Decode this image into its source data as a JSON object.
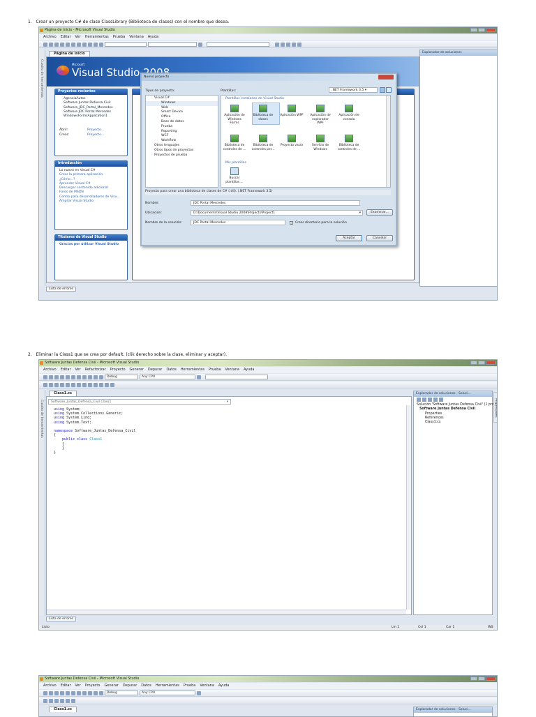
{
  "steps": [
    {
      "number": "1.",
      "text": "Crear un proyecto C# de clase ClassLibrary (Biblioteca de clases) con el nombre que desea."
    },
    {
      "number": "2.",
      "text": "Eliminar la Class1 que se crea por default. (clik derecho sobre la clase, eliminar y aceptar)."
    }
  ],
  "shot1": {
    "title": "Página de inicio - Microsoft Visual Studio",
    "menu": [
      "Archivo",
      "Editar",
      "Ver",
      "Herramientas",
      "Prueba",
      "Ventana",
      "Ayuda"
    ],
    "side_strip": "Cuadro de herramientas",
    "tab": "Página de inicio",
    "logo_small": "Microsoft",
    "logo": "Visual Studio 2008",
    "recent": {
      "title": "Proyectos recientes",
      "items": [
        "AgenciaAutos",
        "Software Juntas Defensa Civil",
        "Software_JDC_Portal_Mercedes",
        "Software JDC Portal Mercedes",
        "WindowsFormsApplication1"
      ],
      "open_label": "Abrir:",
      "open_link": "Proyecto...",
      "create_label": "Crear:",
      "create_link": "Proyecto..."
    },
    "intro": {
      "title": "Introducción",
      "items": [
        "Lo nuevo en Visual C#",
        "Crear la primera aplicación",
        "¿Cómo...?",
        "Aprender Visual C#",
        "Descargar contenido adicional",
        "Foros de MSDN",
        "Centro para desarrolladores de Visu...",
        "Ampliar Visual Studio"
      ]
    },
    "headlines": {
      "title": "Titulares de Visual Studio",
      "item": "Gracias por utilizar Visual Studio"
    },
    "solution_explorer": "Explorador de soluciones",
    "bottom_tab": "Lista de errores",
    "dialog": {
      "title": "Nuevo proyecto",
      "types_label": "Tipos de proyecto:",
      "types": [
        {
          "t": "Visual C#",
          "l": 0
        },
        {
          "t": "Windows",
          "l": 1
        },
        {
          "t": "Web",
          "l": 1
        },
        {
          "t": "Smart Device",
          "l": 1
        },
        {
          "t": "Office",
          "l": 1
        },
        {
          "t": "Base de datos",
          "l": 1
        },
        {
          "t": "Prueba",
          "l": 1
        },
        {
          "t": "Reporting",
          "l": 1
        },
        {
          "t": "WCF",
          "l": 1
        },
        {
          "t": "Workflow",
          "l": 1
        },
        {
          "t": "Otros lenguajes",
          "l": 0
        },
        {
          "t": "Otros tipos de proyectos",
          "l": 0
        },
        {
          "t": "Proyectos de prueba",
          "l": 0
        }
      ],
      "templates_label": "Plantillas:",
      "framework": ".NET Framework 3.5",
      "installed_label": "Plantillas instaladas de Visual Studio",
      "templates": [
        "Aplicación de Windows Forms",
        "Biblioteca de clases",
        "Aplicación WPF",
        "Aplicación de explorador WPF",
        "Aplicación de consola",
        "Biblioteca de controles de ...",
        "Biblioteca de controles per...",
        "Proyecto vacío",
        "Servicio de Windows",
        "Biblioteca de controles de ..."
      ],
      "my_templates_label": "Mis plantillas",
      "search_templates": "Buscar plantillas ...",
      "description": "Proyecto para crear una biblioteca de clases de C# (.dll). (.NET Framework 3.5)",
      "name_label": "Nombre:",
      "name_value": "JDC Portal Mercedes",
      "location_label": "Ubicación:",
      "location_value": "D:\\Documents\\Visual Studio 2008\\Projects\\Project1",
      "browse": "Examinar...",
      "solution_label": "Nombre de la solución:",
      "solution_value": "JDC Portal Mercedes",
      "create_dir": "Crear directorio para la solución",
      "ok": "Aceptar",
      "cancel": "Cancelar"
    }
  },
  "shot2": {
    "title": "Software Juntas Defensa Civil - Microsoft Visual Studio",
    "menu": [
      "Archivo",
      "Editar",
      "Ver",
      "Refactorizar",
      "Proyecto",
      "Generar",
      "Depurar",
      "Datos",
      "Herramientas",
      "Prueba",
      "Ventana",
      "Ayuda"
    ],
    "config": "Debug",
    "platform": "Any CPU",
    "side_strip": "Cuadro de herramientas",
    "tab": "Class1.cs",
    "nav_combo": "Software_Juntas_Defensa_Civil.Class1",
    "code": {
      "l1": "using",
      "l1b": " System;",
      "l2": "using",
      "l2b": " System.Collections.Generic;",
      "l3": "using",
      "l3b": " System.Linq;",
      "l4": "using",
      "l4b": " System.Text;",
      "l5": "namespace",
      "l5b": " Software_Juntas_Defensa_Civil",
      "l6": "{",
      "l7a": "public",
      "l7b": "class",
      "l7c": "Class1",
      "l8": "{",
      "l9": "}",
      "l10": "}"
    },
    "solution_explorer": {
      "title": "Explorador de soluciones - Soluci...",
      "items": [
        "Solución 'Software Juntas Defensa Civil' (1 proyecto)",
        "Software Juntas Defensa Civil",
        "Properties",
        "References",
        "Class1.cs"
      ]
    },
    "properties_tab": "Propiedades",
    "bottom_tab": "Lista de errores",
    "status": {
      "ready": "Listo",
      "line": "Lín 1",
      "col": "Col 1",
      "car": "Car 1",
      "mode": "INS"
    }
  },
  "shot3": {
    "title": "Software Juntas Defensa Civil - Microsoft Visual Studio",
    "menu": [
      "Archivo",
      "Editar",
      "Ver",
      "Proyecto",
      "Generar",
      "Depurar",
      "Datos",
      "Herramientas",
      "Prueba",
      "Ventana",
      "Ayuda"
    ],
    "config": "Debug",
    "platform": "Any CPU",
    "tab": "Class1.cs",
    "solution_explorer": "Explorador de soluciones - Soluci..."
  }
}
